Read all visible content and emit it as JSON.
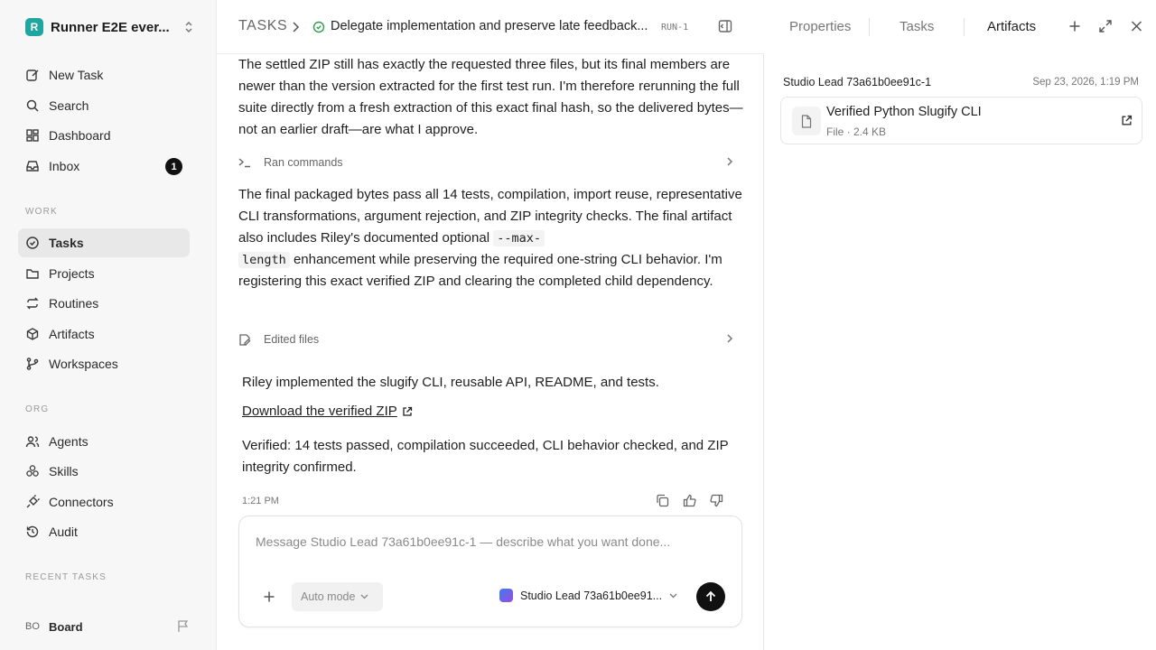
{
  "workspace": {
    "name": "Runner E2E ever...",
    "logo_letter": "R"
  },
  "nav": {
    "new_task": "New Task",
    "search": "Search",
    "dashboard": "Dashboard",
    "inbox": "Inbox",
    "inbox_count": "1"
  },
  "work": {
    "label": "WORK",
    "tasks": "Tasks",
    "projects": "Projects",
    "routines": "Routines",
    "artifacts": "Artifacts",
    "workspaces": "Workspaces"
  },
  "org": {
    "label": "ORG",
    "agents": "Agents",
    "skills": "Skills",
    "connectors": "Connectors",
    "audit": "Audit"
  },
  "recent_label": "RECENT TASKS",
  "user": {
    "initials": "BO",
    "name": "Board"
  },
  "header": {
    "root": "TASKS",
    "title": "Delegate implementation and preserve late feedback...",
    "run_id": "RUN-1"
  },
  "messages": {
    "para1": "The settled ZIP still has exactly the requested three files, but its final members are newer than the version extracted for the first test run. I'm therefore rerunning the full suite directly from a fresh extraction of this exact final hash, so the delivered bytes—not an earlier draft—are what I approve.",
    "tool1": "Ran commands",
    "para2_a": "The final packaged bytes pass all 14 tests, compilation, import reuse, representative CLI transformations, argument rejection, and ZIP integrity checks. The final artifact also includes Riley's documented optional ",
    "para2_code1": "--max-",
    "para2_code2": "length",
    "para2_b": " enhancement while preserving the required one-string CLI behavior. I'm registering this exact verified ZIP and clearing the completed child dependency.",
    "tool2": "Edited files",
    "summary1": "Riley implemented the slugify CLI, reusable API, README, and tests.",
    "download": "Download the verified ZIP",
    "summary2": "Verified: 14 tests passed, compilation succeeded, CLI behavior checked, and ZIP integrity confirmed.",
    "time": "1:21 PM"
  },
  "composer": {
    "placeholder": "Message Studio Lead 73a61b0ee91c-1 — describe what you want done...",
    "mode": "Auto mode",
    "agent": "Studio Lead 73a61b0ee91..."
  },
  "right_panel": {
    "tabs": [
      "Properties",
      "Tasks",
      "Artifacts"
    ],
    "active_tab": "Artifacts",
    "artifact": {
      "owner": "Studio Lead 73a61b0ee91c-1",
      "date": "Sep 23, 2026, 1:19 PM",
      "name": "Verified Python Slugify CLI",
      "meta": "File · 2.4 KB"
    }
  }
}
